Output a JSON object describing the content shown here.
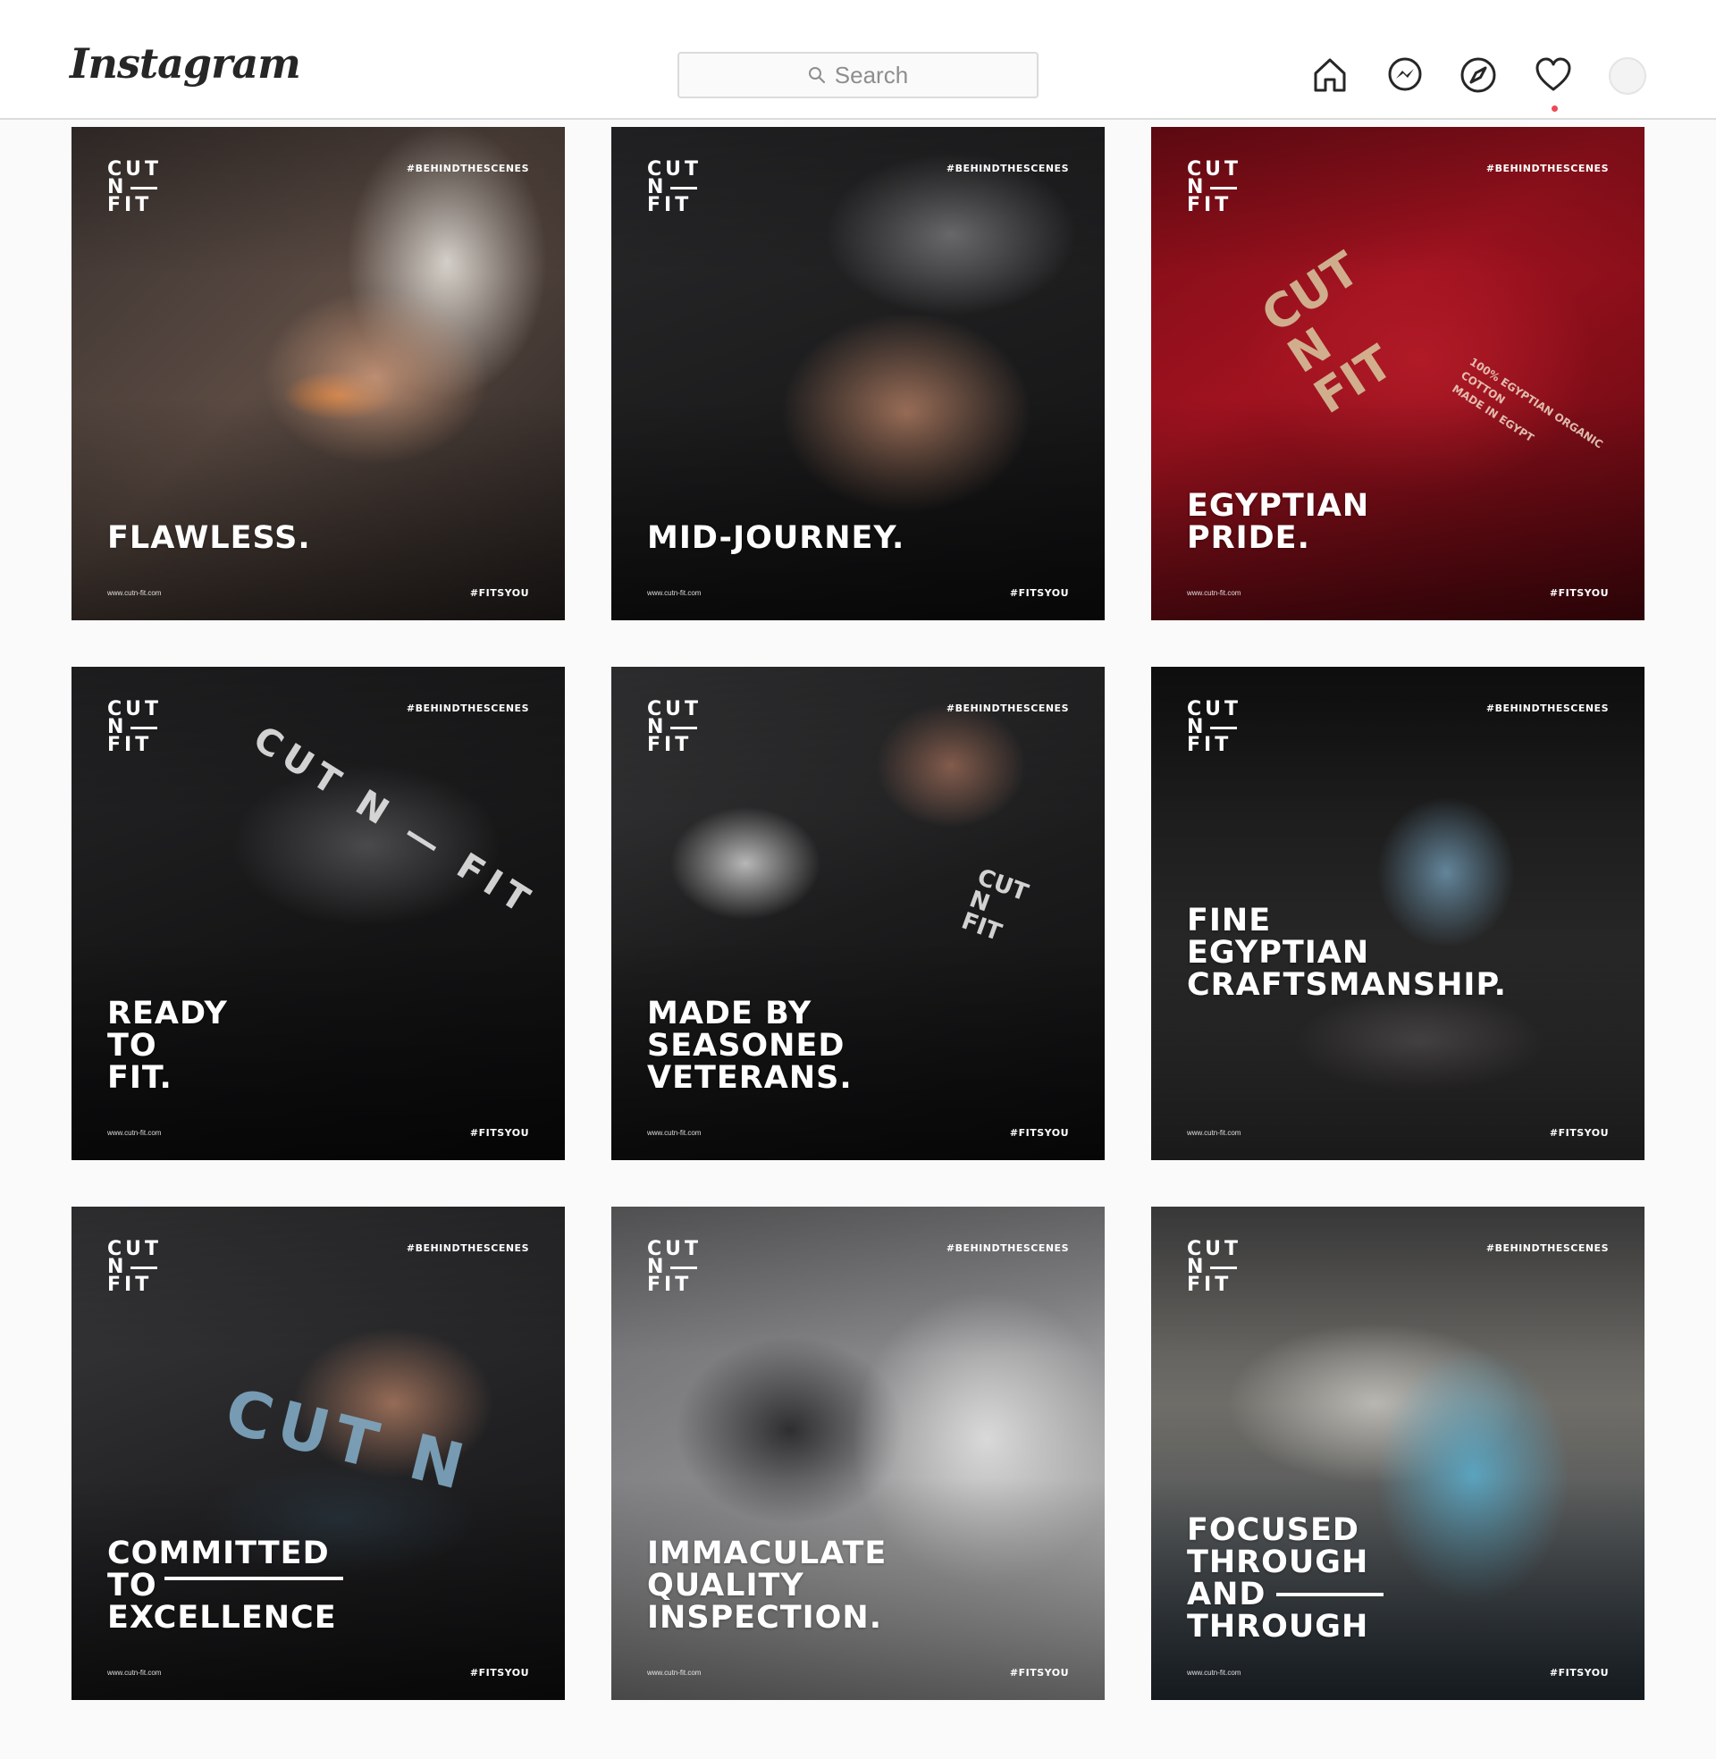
{
  "header": {
    "logo": "Instagram",
    "search_placeholder": "Search",
    "icons": [
      "home-icon",
      "messenger-icon",
      "explore-icon",
      "activity-heart-icon",
      "avatar"
    ],
    "notification_dot_color": "#ed4956"
  },
  "posts": [
    {
      "brand": [
        "CUT",
        "N",
        "FIT"
      ],
      "hashtag_top": "#BEHINDTHESCENES",
      "headline": "FLAWLESS.",
      "website": "www.cutn-fit.com",
      "hashtag_bottom": "#FITSYOU"
    },
    {
      "brand": [
        "CUT",
        "N",
        "FIT"
      ],
      "hashtag_top": "#BEHINDTHESCENES",
      "headline": "MID-JOURNEY.",
      "website": "www.cutn-fit.com",
      "hashtag_bottom": "#FITSYOU"
    },
    {
      "brand": [
        "CUT",
        "N",
        "FIT"
      ],
      "hashtag_top": "#BEHINDTHESCENES",
      "headline": "EGYPTIAN\nPRIDE.",
      "website": "www.cutn-fit.com",
      "hashtag_bottom": "#FITSYOU",
      "photo_text": [
        "CUT",
        "N",
        "FIT",
        "100% EGYPTIAN ORGANIC COTTON",
        "MADE IN EGYPT"
      ]
    },
    {
      "brand": [
        "CUT",
        "N",
        "FIT"
      ],
      "hashtag_top": "#BEHINDTHESCENES",
      "headline": "READY\nTO\nFIT.",
      "website": "www.cutn-fit.com",
      "hashtag_bottom": "#FITSYOU",
      "photo_text": [
        "CUT N",
        "FIT"
      ]
    },
    {
      "brand": [
        "CUT",
        "N",
        "FIT"
      ],
      "hashtag_top": "#BEHINDTHESCENES",
      "headline": "MADE BY\nSEASONED\nVETERANS.",
      "website": "www.cutn-fit.com",
      "hashtag_bottom": "#FITSYOU",
      "photo_text": [
        "CUT",
        "N",
        "FIT"
      ]
    },
    {
      "brand": [
        "CUT",
        "N",
        "FIT"
      ],
      "hashtag_top": "#BEHINDTHESCENES",
      "headline": "FINE\nEGYPTIAN\nCRAFTSMANSHIP.",
      "website": "www.cutn-fit.com",
      "hashtag_bottom": "#FITSYOU"
    },
    {
      "brand": [
        "CUT",
        "N",
        "FIT"
      ],
      "hashtag_top": "#BEHINDTHESCENES",
      "headline": "COMMITTED\nTO\nEXCELLENCE",
      "website": "www.cutn-fit.com",
      "hashtag_bottom": "#FITSYOU",
      "photo_text": [
        "CUT N"
      ]
    },
    {
      "brand": [
        "CUT",
        "N",
        "FIT"
      ],
      "hashtag_top": "#BEHINDTHESCENES",
      "headline": "IMMACULATE\nQUALITY\nINSPECTION.",
      "website": "www.cutn-fit.com",
      "hashtag_bottom": "#FITSYOU"
    },
    {
      "brand": [
        "CUT",
        "N",
        "FIT"
      ],
      "hashtag_top": "#BEHINDTHESCENES",
      "headline": "FOCUSED\nTHROUGH\nAND\nTHROUGH",
      "website": "www.cutn-fit.com",
      "hashtag_bottom": "#FITSYOU"
    }
  ]
}
